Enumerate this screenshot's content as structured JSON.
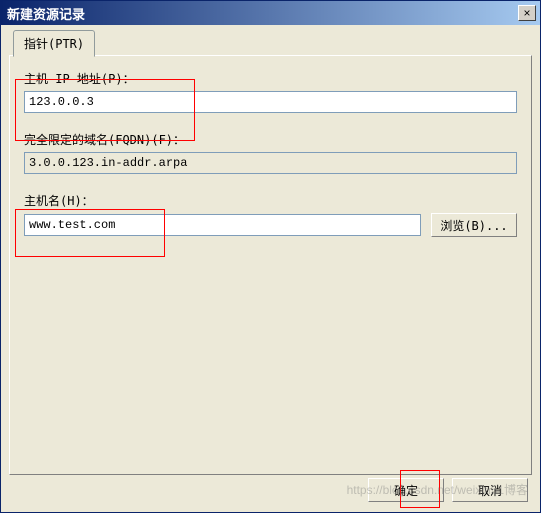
{
  "window": {
    "title": "新建资源记录",
    "close_icon": "×"
  },
  "tab": {
    "label": "指针(PTR)"
  },
  "fields": {
    "ip": {
      "label": "主机 IP 地址(P)：",
      "value": "123.0.0.3"
    },
    "fqdn": {
      "label": "完全限定的域名(FQDN)(F)：",
      "value": "3.0.0.123.in-addr.arpa"
    },
    "host": {
      "label": "主机名(H)：",
      "value": "www.test.com",
      "browse_label": "浏览(B)..."
    }
  },
  "buttons": {
    "ok": "确定",
    "cancel": "取消"
  },
  "watermark": "https://blog.csdn.net/weixin51博客"
}
